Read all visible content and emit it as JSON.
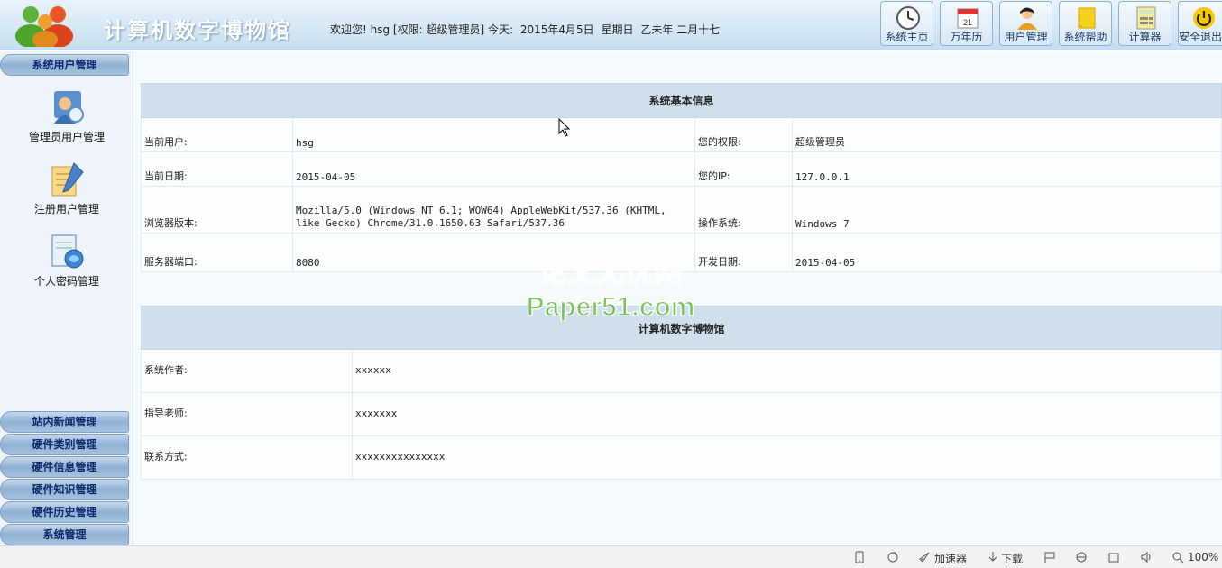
{
  "header": {
    "site_title": "计算机数字博物馆",
    "welcome": "欢迎您! hsg [权限: 超级管理员] 今天:",
    "date": "2015年4月5日",
    "weekday": "星期日",
    "lunar": "乙未年 二月十七",
    "buttons": [
      {
        "label": "系统主页",
        "icon": "clock-icon"
      },
      {
        "label": "万年历",
        "icon": "calendar-icon"
      },
      {
        "label": "用户管理",
        "icon": "user-icon"
      },
      {
        "label": "系统帮助",
        "icon": "help-note-icon"
      },
      {
        "label": "计算器",
        "icon": "calculator-icon"
      },
      {
        "label": "安全退出",
        "icon": "power-icon"
      }
    ]
  },
  "sidebar": {
    "top_group": "系统用户管理",
    "items": [
      {
        "label": "管理员用户管理",
        "icon": "admin-user-icon"
      },
      {
        "label": "注册用户管理",
        "icon": "register-user-icon"
      },
      {
        "label": "个人密码管理",
        "icon": "password-icon"
      }
    ],
    "groups": [
      "站内新闻管理",
      "硬件类别管理",
      "硬件信息管理",
      "硬件知识管理",
      "硬件历史管理",
      "系统管理"
    ]
  },
  "info_table": {
    "title": "系统基本信息",
    "rows": [
      {
        "l1": "当前用户:",
        "v1": "hsg",
        "l2": "您的权限:",
        "v2": "超级管理员"
      },
      {
        "l1": "当前日期:",
        "v1": "2015-04-05",
        "l2": "您的IP:",
        "v2": "127.0.0.1"
      },
      {
        "l1": "浏览器版本:",
        "v1": "Mozilla/5.0 (Windows NT 6.1; WOW64) AppleWebKit/537.36 (KHTML, like Gecko) Chrome/31.0.1650.63 Safari/537.36",
        "l2": "操作系统:",
        "v2": "Windows 7"
      },
      {
        "l1": "服务器端口:",
        "v1": "8080",
        "l2": "开发日期:",
        "v2": "2015-04-05"
      }
    ]
  },
  "about_table": {
    "title": "计算机数字博物馆",
    "rows": [
      {
        "label": "系统作者:",
        "value": "xxxxxx"
      },
      {
        "label": "指导老师:",
        "value": "xxxxxxx"
      },
      {
        "label": "联系方式:",
        "value": "xxxxxxxxxxxxxxx"
      }
    ]
  },
  "watermark": {
    "line1": "论文无忧网",
    "line2": "Paper51.com"
  },
  "statusbar": {
    "accelerator": "加速器",
    "download": "下载",
    "zoom": "100%"
  },
  "colors": {
    "accent": "#1d3a66",
    "header_bg": "#d5e7f4",
    "table_head": "#cfe0ec",
    "watermark_green": "#6cc24a"
  }
}
